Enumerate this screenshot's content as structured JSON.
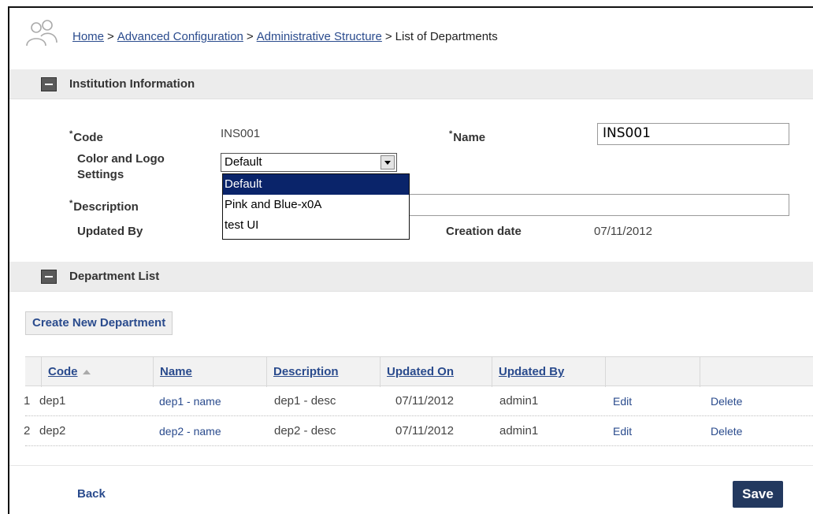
{
  "breadcrumb": {
    "items": [
      "Home",
      "Advanced Configuration",
      "Administrative Structure"
    ],
    "separator": ">",
    "current": "List of Departments"
  },
  "institution": {
    "section_title": "Institution Information",
    "code_label": "Code",
    "code_value": "INS001",
    "name_label": "Name",
    "name_value": "INS001",
    "color_logo_label_1": "Color and Logo",
    "color_logo_label_2": "Settings",
    "color_logo_selected": "Default",
    "color_logo_options": [
      "Default",
      "Pink and Blue-x0A",
      "test UI"
    ],
    "description_label": "Description",
    "description_value": "",
    "updated_by_label": "Updated By",
    "creation_date_label": "Creation date",
    "creation_date_value": "07/11/2012",
    "required_mark": "*"
  },
  "departments": {
    "section_title": "Department List",
    "create_button": "Create New Department",
    "columns": [
      "Code",
      "Name",
      "Description",
      "Updated On",
      "Updated By",
      "",
      ""
    ],
    "rows": [
      {
        "num": "1",
        "code": "dep1",
        "name": "dep1 - name",
        "description": "dep1 - desc",
        "updated_on": "07/11/2012",
        "updated_by": "admin1",
        "edit": "Edit",
        "delete": "Delete"
      },
      {
        "num": "2",
        "code": "dep2",
        "name": "dep2 - name",
        "description": "dep2 - desc",
        "updated_on": "07/11/2012",
        "updated_by": "admin1",
        "edit": "Edit",
        "delete": "Delete"
      }
    ]
  },
  "footer": {
    "back_label": "Back",
    "save_label": "Save"
  },
  "colors": {
    "link": "#2a4b8d",
    "save_button": "#23395f",
    "dropdown_highlight": "#0a246a",
    "section_header": "#ececec"
  },
  "icons": [
    "user-group-icon",
    "collapse-icon",
    "sort-ascending-icon",
    "dropdown-arrow-icon"
  ]
}
